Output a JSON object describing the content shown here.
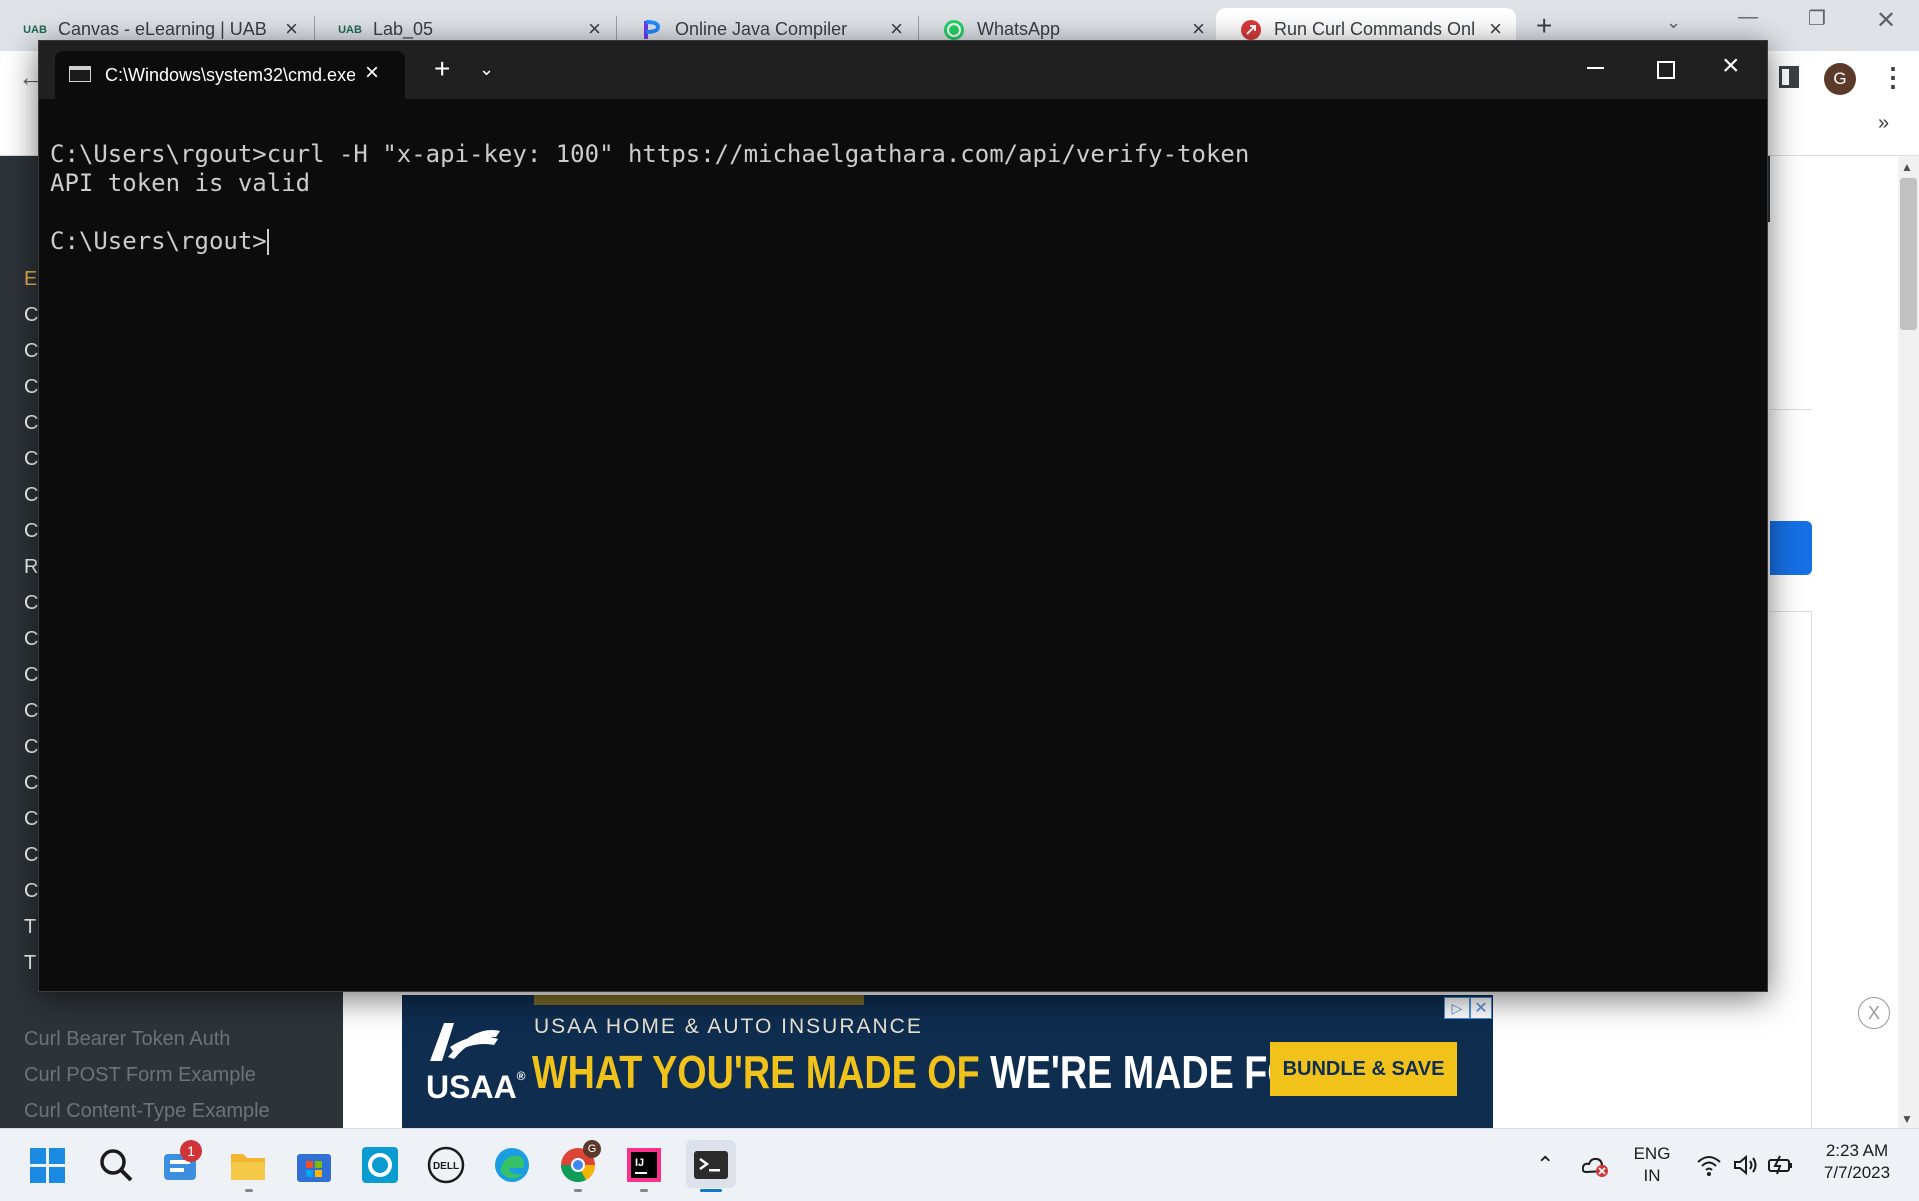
{
  "browser": {
    "tabs": [
      {
        "label": "Canvas - eLearning | UAB",
        "favicon": "uab-logo"
      },
      {
        "label": "Lab_05",
        "favicon": "uab-logo"
      },
      {
        "label": "Online Java Compiler",
        "favicon": "programiz-logo"
      },
      {
        "label": "WhatsApp",
        "favicon": "whatsapp-icon"
      },
      {
        "label": "Run Curl Commands Onli",
        "favicon": "reqbin-icon"
      }
    ],
    "favicon_text": "UAB",
    "profile_initial": "G",
    "extensions_chevron": "»",
    "account_label": "Account"
  },
  "page": {
    "sidebar_items": [
      {
        "label": "E"
      },
      {
        "label": "C"
      },
      {
        "label": "C"
      },
      {
        "label": "C"
      },
      {
        "label": "C"
      },
      {
        "label": "C"
      },
      {
        "label": "C"
      },
      {
        "label": "C"
      },
      {
        "label": "R"
      },
      {
        "label": "C"
      },
      {
        "label": "C"
      },
      {
        "label": "C"
      },
      {
        "label": "C"
      },
      {
        "label": "C"
      },
      {
        "label": "C"
      },
      {
        "label": "C"
      },
      {
        "label": "C"
      },
      {
        "label": "C"
      },
      {
        "label": "T"
      },
      {
        "label": "T"
      }
    ],
    "sidebar_faded_items": [
      "Curl Bearer Token Auth",
      "Curl POST Form Example",
      "Curl Content-Type Example"
    ]
  },
  "ad": {
    "logo": "USAA",
    "subtitle": "USAA HOME & AUTO INSURANCE",
    "headline_gold": "WHAT YOU'RE MADE OF",
    "headline_white": "WE'RE MADE FOR",
    "trademark": "™",
    "cta": "BUNDLE & SAVE",
    "close_label": "X",
    "adchoices_label": "▷",
    "ad_x_label": "✕",
    "colors": {
      "background": "#0e2d4f",
      "gold": "#f0c21a"
    }
  },
  "terminal": {
    "tab_title": "C:\\Windows\\system32\\cmd.exe",
    "lines": [
      "C:\\Users\\rgout>curl -H \"x-api-key: 100\" https://michaelgathara.com/api/verify-token",
      "API token is valid",
      "",
      "C:\\Users\\rgout>"
    ]
  },
  "taskbar": {
    "notification_badge": "1",
    "chrome_badge": "G",
    "language_line1": "ENG",
    "language_line2": "IN",
    "time": "2:23 AM",
    "date": "7/7/2023"
  }
}
